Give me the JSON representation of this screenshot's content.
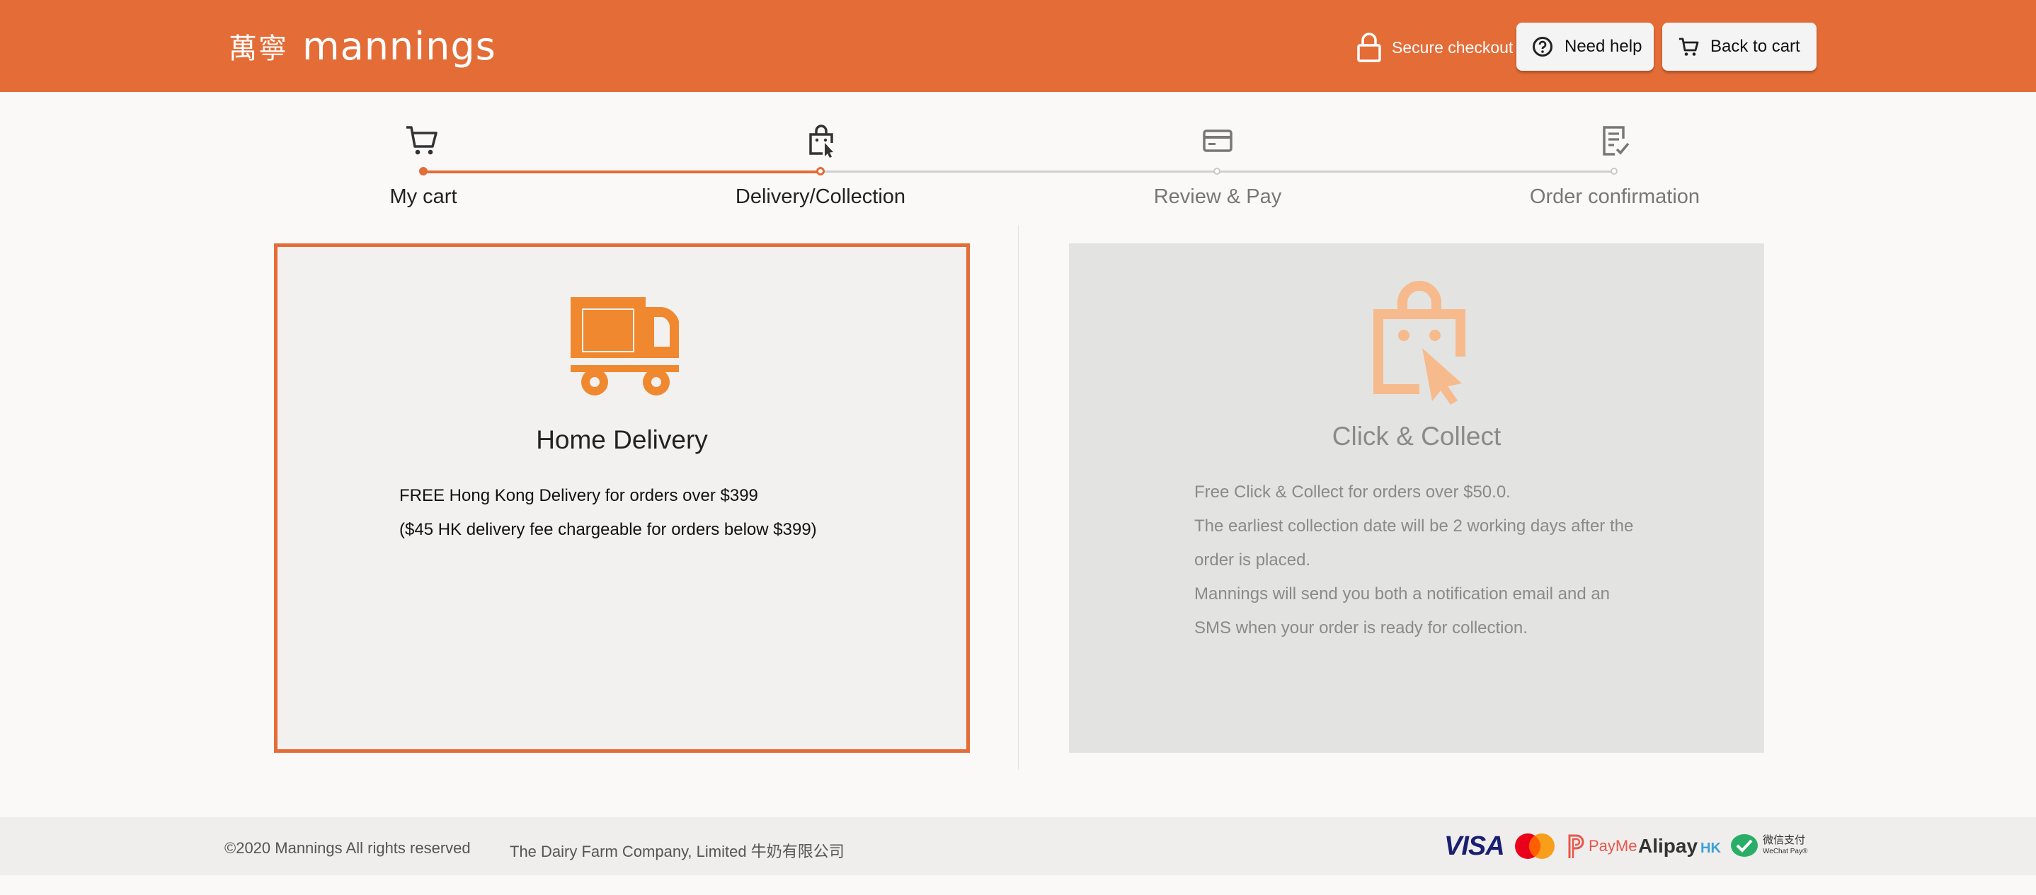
{
  "header": {
    "logo_cn": "萬寧",
    "logo_en": "mannings",
    "secure_label": "Secure checkout",
    "help_label": "Need help",
    "cart_label": "Back to cart"
  },
  "steps": [
    {
      "label": "My cart",
      "icon": "cart-icon",
      "state": "done"
    },
    {
      "label": "Delivery/Collection",
      "icon": "bag-cursor-icon",
      "state": "current"
    },
    {
      "label": "Review & Pay",
      "icon": "card-icon",
      "state": "todo"
    },
    {
      "label": "Order confirmation",
      "icon": "receipt-check-icon",
      "state": "todo"
    }
  ],
  "options": {
    "home": {
      "title": "Home Delivery",
      "icon": "truck-icon",
      "lines": [
        "FREE Hong Kong Delivery for orders over $399",
        "($45 HK delivery fee chargeable for orders below $399)"
      ]
    },
    "collect": {
      "title": "Click & Collect",
      "icon": "bag-cursor-icon",
      "lines": [
        "Free Click & Collect for orders over $50.0.",
        "The earliest collection date will be 2 working days after the",
        "order is placed.",
        "Mannings will send you both a notification email and an",
        "SMS when your order is ready for collection."
      ]
    }
  },
  "footer": {
    "copyright": "©2020 Mannings All rights reserved",
    "company": "The Dairy Farm Company, Limited 牛奶有限公司",
    "payments": {
      "visa": "VISA",
      "payme": "PayMe",
      "alipay": "Alipay",
      "alipay_hk": "HK",
      "wechat_cn": "微信支付",
      "wechat_en": "WeChat Pay®"
    }
  },
  "colors": {
    "brand": "#e46c37",
    "icon_orange": "#f0882f",
    "muted_text": "#8a8a8a"
  }
}
